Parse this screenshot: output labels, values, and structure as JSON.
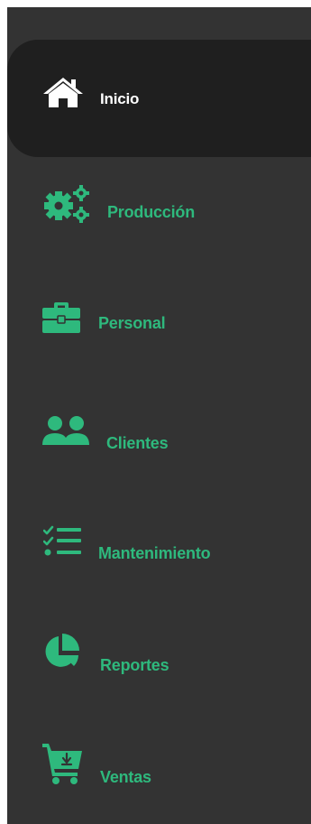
{
  "theme": {
    "sidebar_bg": "#333333",
    "active_bg": "#1f1f1f",
    "accent": "#2eb97d",
    "active_text": "#ffffff"
  },
  "sidebar": {
    "items": [
      {
        "label": "Inicio",
        "icon": "home-icon",
        "active": true
      },
      {
        "label": "Producción",
        "icon": "gears-icon",
        "active": false
      },
      {
        "label": "Personal",
        "icon": "briefcase-icon",
        "active": false
      },
      {
        "label": "Clientes",
        "icon": "users-icon",
        "active": false
      },
      {
        "label": "Mantenimiento",
        "icon": "task-list-icon",
        "active": false
      },
      {
        "label": "Reportes",
        "icon": "pie-chart-icon",
        "active": false
      },
      {
        "label": "Ventas",
        "icon": "cart-icon",
        "active": false
      }
    ]
  }
}
